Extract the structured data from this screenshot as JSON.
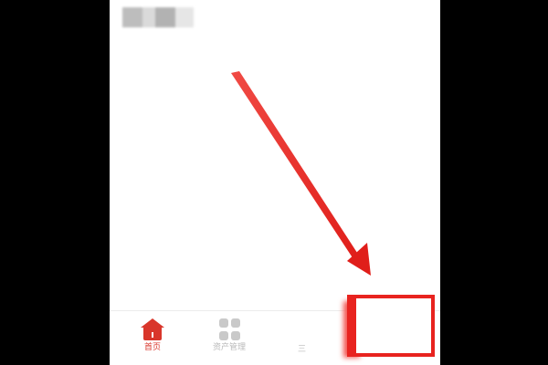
{
  "screen": {
    "background": "#ffffff",
    "letterbox": "#000000"
  },
  "header": {
    "account_name": ""
  },
  "tabbar": {
    "tabs": [
      {
        "label": "首页",
        "icon": "home-icon",
        "active": true
      },
      {
        "label": "资产管理",
        "icon": "grid-icon",
        "active": false
      },
      {
        "label": "三",
        "icon": "",
        "active": false
      }
    ]
  },
  "annotation": {
    "arrow": "red-arrow",
    "highlight": "red-box",
    "color": "#e8231f"
  },
  "colors": {
    "accent": "#d9362b",
    "inactive": "#b9b9b9"
  }
}
